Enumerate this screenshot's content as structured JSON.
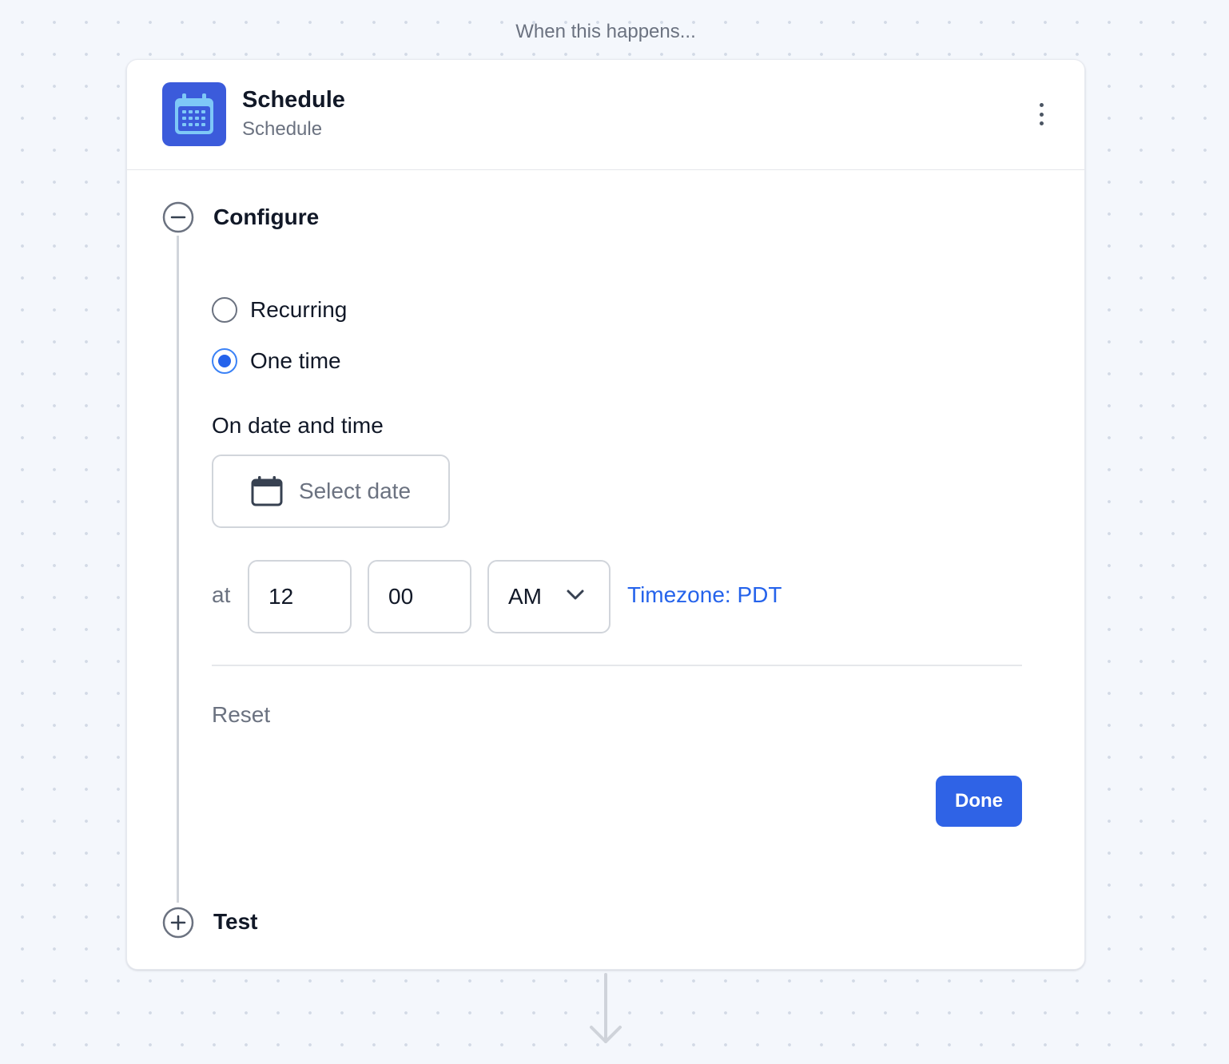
{
  "trigger_label": "When this happens...",
  "step": {
    "title": "Schedule",
    "subtitle": "Schedule",
    "icon": "calendar-icon",
    "icon_bg": "#3b5bdb"
  },
  "configure": {
    "title": "Configure",
    "options": [
      {
        "label": "Recurring",
        "checked": false
      },
      {
        "label": "One time",
        "checked": true
      }
    ],
    "date_label": "On date and time",
    "date_placeholder": "Select date",
    "at_label": "at",
    "hour": "12",
    "minute": "00",
    "ampm": "AM",
    "timezone": "Timezone: PDT",
    "reset_label": "Reset",
    "done_label": "Done"
  },
  "test": {
    "title": "Test"
  },
  "colors": {
    "accent": "#2f63e6",
    "link": "#2563eb",
    "radio": "#2563eb"
  }
}
